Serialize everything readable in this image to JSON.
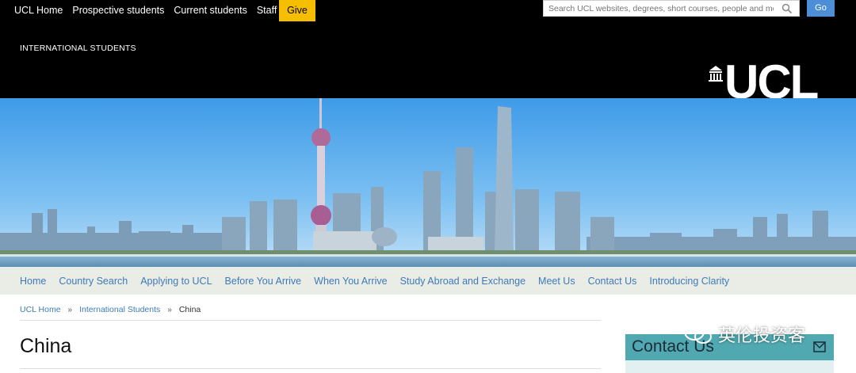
{
  "topbar": {
    "links": [
      "UCL Home",
      "Prospective students",
      "Current students",
      "Staff"
    ],
    "give_label": "Give",
    "search_placeholder": "Search UCL websites, degrees, short courses, people and more",
    "go_label": "Go"
  },
  "masthead": {
    "site_title": "INTERNATIONAL STUDENTS",
    "logo_text": "UCL"
  },
  "nav": {
    "items": [
      "Home",
      "Country Search",
      "Applying to UCL",
      "Before You Arrive",
      "When You Arrive",
      "Study Abroad and Exchange",
      "Meet Us",
      "Contact Us",
      "Introducing Clarity"
    ]
  },
  "breadcrumb": {
    "items": [
      "UCL Home",
      "International Students"
    ],
    "separator": "»",
    "current": "China"
  },
  "page": {
    "title": "China"
  },
  "sidebar": {
    "contact_label": "Contact Us"
  },
  "watermark": {
    "text": "英伦投资客"
  },
  "colors": {
    "give": "#f6be00",
    "go": "#4c8fd6",
    "link": "#3f7ab8",
    "nav_bg": "#eaece6",
    "contact_bg": "#50a8b0"
  }
}
